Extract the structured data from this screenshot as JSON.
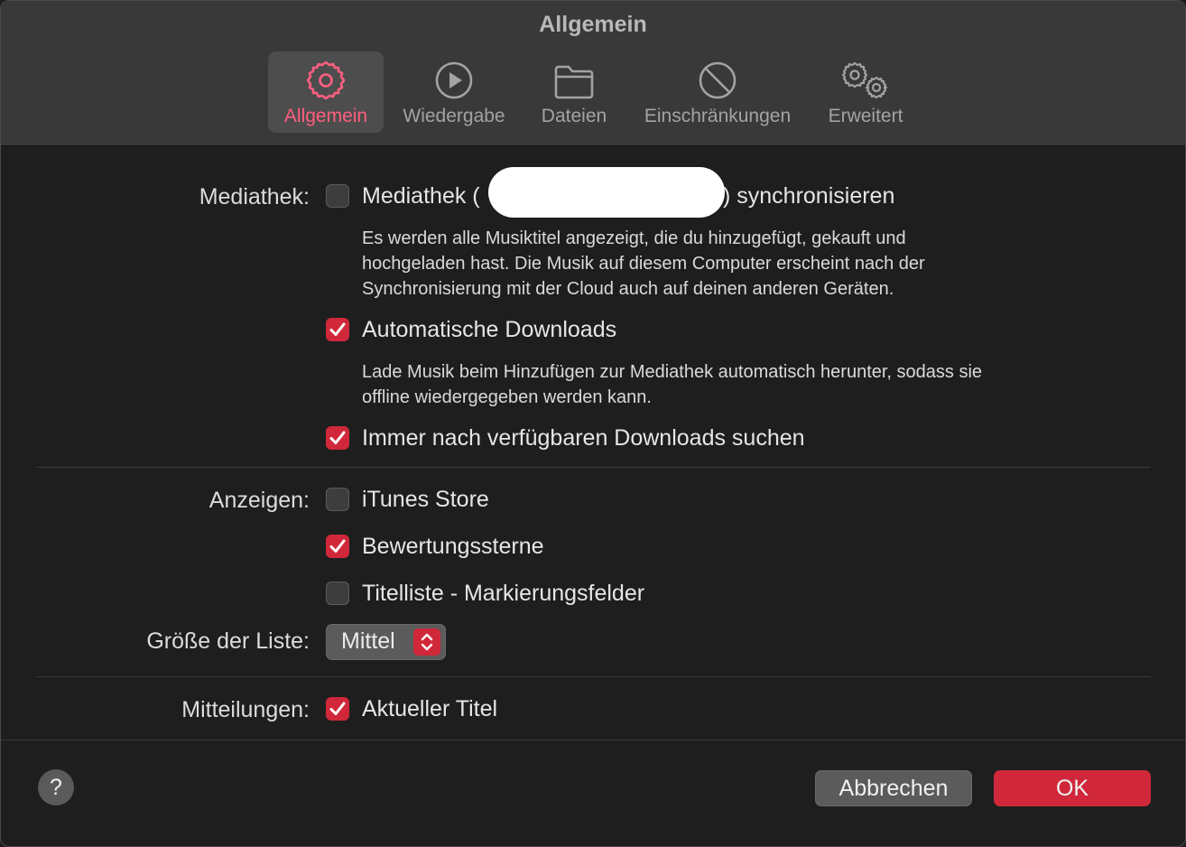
{
  "window": {
    "title": "Allgemein"
  },
  "tabs": [
    {
      "label": "Allgemein",
      "icon": "gear-icon",
      "active": true
    },
    {
      "label": "Wiedergabe",
      "icon": "play-circle-icon",
      "active": false
    },
    {
      "label": "Dateien",
      "icon": "folder-icon",
      "active": false
    },
    {
      "label": "Einschränkungen",
      "icon": "prohibited-icon",
      "active": false
    },
    {
      "label": "Erweitert",
      "icon": "gears-icon",
      "active": false
    }
  ],
  "library": {
    "section_label": "Mediathek:",
    "sync": {
      "label_prefix": "Mediathek (",
      "label_suffix": ") synchronisieren",
      "checked": false
    },
    "sync_description": [
      "Es werden alle Musiktitel angezeigt, die du hinzugefügt, gekauft und",
      "hochgeladen hast. Die Musik auf diesem Computer erscheint nach der",
      "Synchronisierung mit der Cloud auch auf deinen anderen Geräten."
    ],
    "auto_downloads": {
      "label": "Automatische Downloads",
      "checked": true
    },
    "auto_downloads_description": [
      "Lade Musik beim Hinzufügen zur Mediathek automatisch herunter, sodass sie",
      "offline wiedergegeben werden kann."
    ],
    "check_downloads": {
      "label": "Immer nach verfügbaren Downloads suchen",
      "checked": true
    }
  },
  "show": {
    "section_label": "Anzeigen:",
    "itunes_store": {
      "label": "iTunes Store",
      "checked": false
    },
    "star_ratings": {
      "label": "Bewertungssterne",
      "checked": true
    },
    "song_checkboxes": {
      "label": "Titelliste - Markierungsfelder",
      "checked": false
    }
  },
  "list_size": {
    "label": "Größe der Liste:",
    "value": "Mittel"
  },
  "notifications": {
    "section_label": "Mitteilungen:",
    "now_playing": {
      "label": "Aktueller Titel",
      "checked": true
    }
  },
  "footer": {
    "help": "?",
    "cancel": "Abbrechen",
    "ok": "OK"
  },
  "colors": {
    "accent": "#d0283a",
    "active_tab": "#ff5f7f"
  }
}
